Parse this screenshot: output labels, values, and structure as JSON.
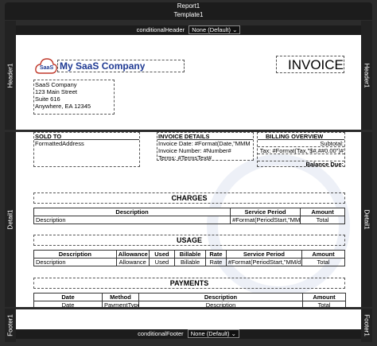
{
  "report_label": "Report1",
  "template_label": "Template1",
  "conditional_header": {
    "label": "conditionalHeader",
    "value": "None (Default)"
  },
  "conditional_footer": {
    "label": "conditionalFooter",
    "value": "None (Default)"
  },
  "side_labels": {
    "header": "Header1",
    "detail": "Detail1",
    "footer": "Footer1"
  },
  "header": {
    "logo_text": "SaaS",
    "company_title": "My SaaS Company",
    "invoice_title": "INVOICE",
    "address_lines": [
      "SaaS Company",
      "123 Main Street",
      "Suite 616",
      "Anywhere, EA 12345"
    ]
  },
  "detail": {
    "sold_to_label": "SOLD TO",
    "sold_to_value": "FormattedAddress",
    "invoice_details_label": "INVOICE DETAILS",
    "invoice_details_lines": [
      "Invoice Date: #Format(Date,\"MMM d,",
      "Invoice Number: #Number#",
      "Terms: #TermsText#"
    ],
    "billing_overview_label": "BILLING OVERVIEW",
    "billing_lines": [
      "Subtotal:",
      "Tax: #Format(Tax,\"$#,##0.00\")#",
      "",
      "Balance Due:"
    ],
    "charges": {
      "title": "CHARGES",
      "headers": [
        "Description",
        "Service Period",
        "Amount"
      ],
      "row": [
        "Description",
        "#Format(PeriodStart,\"MM/d",
        "Total"
      ]
    },
    "usage": {
      "title": "USAGE",
      "headers": [
        "Description",
        "Allowance",
        "Used",
        "Billable",
        "Rate",
        "Service Period",
        "Amount"
      ],
      "row": [
        "Description",
        "Allowance",
        "Used",
        "Billable",
        "Rate",
        "#Format(PeriodStart,\"MM/d",
        "Total"
      ]
    },
    "payments": {
      "title": "PAYMENTS",
      "headers": [
        "Date",
        "Method",
        "Description",
        "Amount"
      ],
      "row": [
        "Date",
        "PaymentType",
        "Description",
        "Total"
      ]
    }
  },
  "colors": {
    "brand": "#1f3a93",
    "logo_red": "#c0392b"
  }
}
